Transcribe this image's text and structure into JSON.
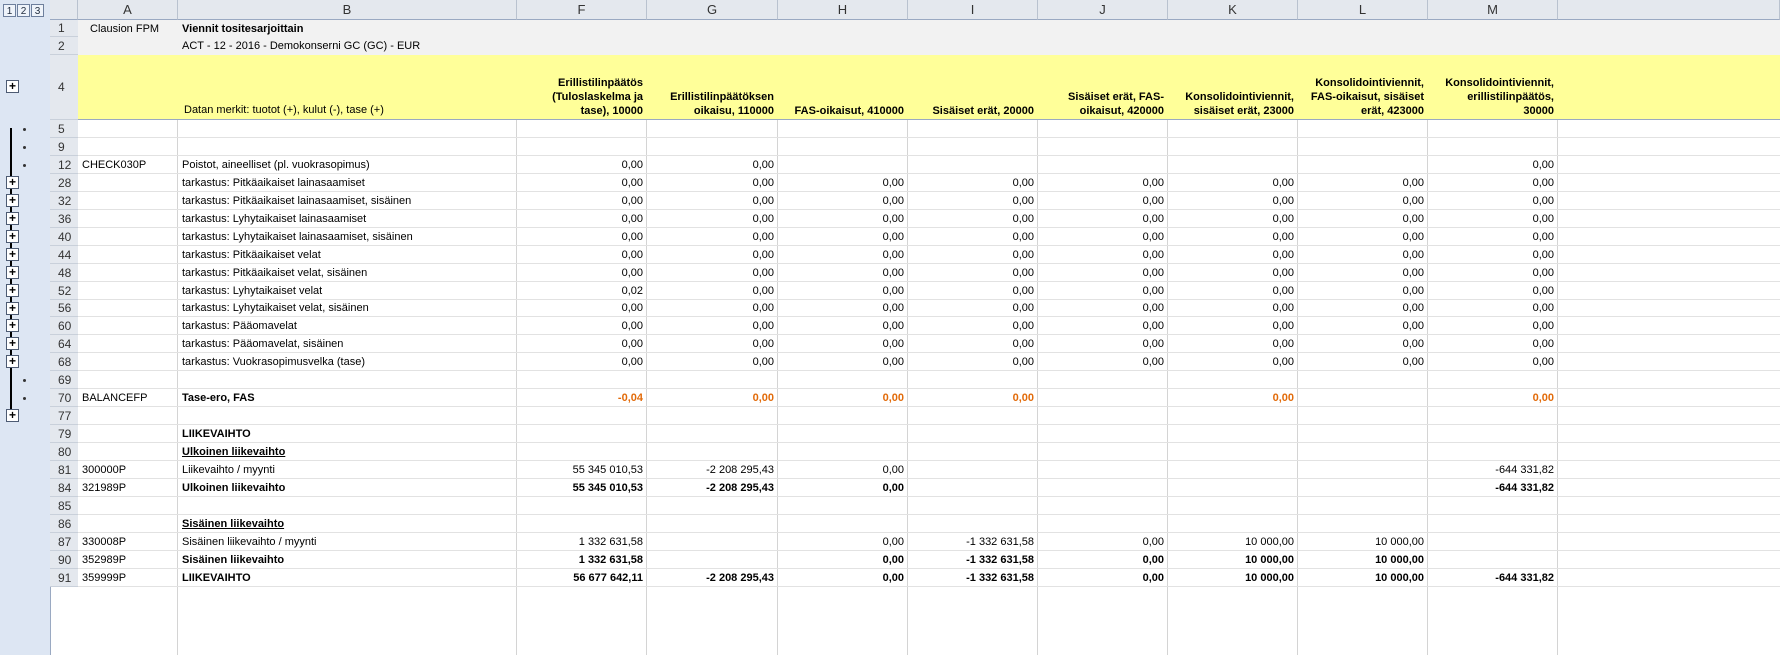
{
  "outline": {
    "levels": [
      "1",
      "2",
      "3"
    ],
    "plus_glyph": "+"
  },
  "columns": [
    "A",
    "B",
    "F",
    "G",
    "H",
    "I",
    "J",
    "K",
    "L",
    "M"
  ],
  "header": {
    "a1": "Clausion FPM",
    "b1": "Viennit tositesarjoittain",
    "b2": "ACT - 12 - 2016 - Demokonserni GC (GC) - EUR",
    "b4": "Datan merkit: tuotot (+), kulut (-), tase (+)",
    "f4": "Erillistilinpäätös\n(Tuloslaskelma ja\ntase), 10000",
    "g4": "Erillistilinpäätöksen\noikaisu, 110000",
    "h4": "FAS-oikaisut, 410000",
    "i4": "Sisäiset erät, 20000",
    "j4": "Sisäiset erät, FAS-\noikaisut, 420000",
    "k4": "Konsolidointiviennit,\nsisäiset erät, 23000",
    "l4": "Konsolidointiviennit,\nFAS-oikaisut, sisäiset\nerät, 423000",
    "m4": "Konsolidointiviennit,\nerillistilinpäätös,\n30000"
  },
  "rows": [
    {
      "n": "5",
      "a": "",
      "b": "",
      "f": "",
      "g": "",
      "h": "",
      "i": "",
      "j": "",
      "k": "",
      "l": "",
      "m": ""
    },
    {
      "n": "9",
      "a": "",
      "b": "",
      "f": "",
      "g": "",
      "h": "",
      "i": "",
      "j": "",
      "k": "",
      "l": "",
      "m": ""
    },
    {
      "n": "12",
      "a": "CHECK030P",
      "b": "Poistot, aineelliset (pl. vuokrasopimus)",
      "f": "0,00",
      "g": "0,00",
      "h": "",
      "i": "",
      "j": "",
      "k": "",
      "l": "",
      "m": "0,00"
    },
    {
      "n": "28",
      "a": "",
      "b": "tarkastus: Pitkäaikaiset lainasaamiset",
      "f": "0,00",
      "g": "0,00",
      "h": "0,00",
      "i": "0,00",
      "j": "0,00",
      "k": "0,00",
      "l": "0,00",
      "m": "0,00"
    },
    {
      "n": "32",
      "a": "",
      "b": "tarkastus: Pitkäaikaiset lainasaamiset, sisäinen",
      "f": "0,00",
      "g": "0,00",
      "h": "0,00",
      "i": "0,00",
      "j": "0,00",
      "k": "0,00",
      "l": "0,00",
      "m": "0,00"
    },
    {
      "n": "36",
      "a": "",
      "b": "tarkastus: Lyhytaikaiset lainasaamiset",
      "f": "0,00",
      "g": "0,00",
      "h": "0,00",
      "i": "0,00",
      "j": "0,00",
      "k": "0,00",
      "l": "0,00",
      "m": "0,00"
    },
    {
      "n": "40",
      "a": "",
      "b": "tarkastus: Lyhytaikaiset lainasaamiset, sisäinen",
      "f": "0,00",
      "g": "0,00",
      "h": "0,00",
      "i": "0,00",
      "j": "0,00",
      "k": "0,00",
      "l": "0,00",
      "m": "0,00"
    },
    {
      "n": "44",
      "a": "",
      "b": "tarkastus: Pitkäaikaiset velat",
      "f": "0,00",
      "g": "0,00",
      "h": "0,00",
      "i": "0,00",
      "j": "0,00",
      "k": "0,00",
      "l": "0,00",
      "m": "0,00"
    },
    {
      "n": "48",
      "a": "",
      "b": "tarkastus: Pitkäaikaiset velat, sisäinen",
      "f": "0,00",
      "g": "0,00",
      "h": "0,00",
      "i": "0,00",
      "j": "0,00",
      "k": "0,00",
      "l": "0,00",
      "m": "0,00"
    },
    {
      "n": "52",
      "a": "",
      "b": "tarkastus: Lyhytaikaiset velat",
      "f": "0,02",
      "g": "0,00",
      "h": "0,00",
      "i": "0,00",
      "j": "0,00",
      "k": "0,00",
      "l": "0,00",
      "m": "0,00"
    },
    {
      "n": "56",
      "a": "",
      "b": "tarkastus: Lyhytaikaiset velat, sisäinen",
      "f": "0,00",
      "g": "0,00",
      "h": "0,00",
      "i": "0,00",
      "j": "0,00",
      "k": "0,00",
      "l": "0,00",
      "m": "0,00"
    },
    {
      "n": "60",
      "a": "",
      "b": "tarkastus: Pääomavelat",
      "f": "0,00",
      "g": "0,00",
      "h": "0,00",
      "i": "0,00",
      "j": "0,00",
      "k": "0,00",
      "l": "0,00",
      "m": "0,00"
    },
    {
      "n": "64",
      "a": "",
      "b": "tarkastus: Pääomavelat, sisäinen",
      "f": "0,00",
      "g": "0,00",
      "h": "0,00",
      "i": "0,00",
      "j": "0,00",
      "k": "0,00",
      "l": "0,00",
      "m": "0,00"
    },
    {
      "n": "68",
      "a": "",
      "b": "tarkastus: Vuokrasopimusvelka (tase)",
      "f": "0,00",
      "g": "0,00",
      "h": "0,00",
      "i": "0,00",
      "j": "0,00",
      "k": "0,00",
      "l": "0,00",
      "m": "0,00"
    },
    {
      "n": "69",
      "a": "",
      "b": "",
      "f": "",
      "g": "",
      "h": "",
      "i": "",
      "j": "",
      "k": "",
      "l": "",
      "m": ""
    },
    {
      "n": "70",
      "a": "BALANCEFP",
      "b": "Tase-ero, FAS",
      "f": "-0,04",
      "g": "0,00",
      "h": "0,00",
      "i": "0,00",
      "j": "",
      "k": "0,00",
      "l": "",
      "m": "0,00",
      "style": "orange"
    },
    {
      "n": "77",
      "a": "",
      "b": "",
      "f": "",
      "g": "",
      "h": "",
      "i": "",
      "j": "",
      "k": "",
      "l": "",
      "m": ""
    },
    {
      "n": "79",
      "a": "",
      "b": "LIIKEVAIHTO",
      "f": "",
      "g": "",
      "h": "",
      "i": "",
      "j": "",
      "k": "",
      "l": "",
      "m": "",
      "style": "bold"
    },
    {
      "n": "80",
      "a": "",
      "b": "Ulkoinen liikevaihto",
      "f": "",
      "g": "",
      "h": "",
      "i": "",
      "j": "",
      "k": "",
      "l": "",
      "m": "",
      "style": "underline"
    },
    {
      "n": "81",
      "a": "300000P",
      "b": "Liikevaihto / myynti",
      "f": "55 345 010,53",
      "g": "-2 208 295,43",
      "h": "0,00",
      "i": "",
      "j": "",
      "k": "",
      "l": "",
      "m": "-644 331,82"
    },
    {
      "n": "84",
      "a": "321989P",
      "b": "Ulkoinen liikevaihto",
      "f": "55 345 010,53",
      "g": "-2 208 295,43",
      "h": "0,00",
      "i": "",
      "j": "",
      "k": "",
      "l": "",
      "m": "-644 331,82",
      "style": "bold"
    },
    {
      "n": "85",
      "a": "",
      "b": "",
      "f": "",
      "g": "",
      "h": "",
      "i": "",
      "j": "",
      "k": "",
      "l": "",
      "m": ""
    },
    {
      "n": "86",
      "a": "",
      "b": "Sisäinen liikevaihto",
      "f": "",
      "g": "",
      "h": "",
      "i": "",
      "j": "",
      "k": "",
      "l": "",
      "m": "",
      "style": "underline"
    },
    {
      "n": "87",
      "a": "330008P",
      "b": "Sisäinen liikevaihto / myynti",
      "f": "1 332 631,58",
      "g": "",
      "h": "0,00",
      "i": "-1 332 631,58",
      "j": "0,00",
      "k": "10 000,00",
      "l": "10 000,00",
      "m": ""
    },
    {
      "n": "90",
      "a": "352989P",
      "b": "Sisäinen liikevaihto",
      "f": "1 332 631,58",
      "g": "",
      "h": "0,00",
      "i": "-1 332 631,58",
      "j": "0,00",
      "k": "10 000,00",
      "l": "10 000,00",
      "m": "",
      "style": "bold"
    },
    {
      "n": "91",
      "a": "359999P",
      "b": "LIIKEVAIHTO",
      "f": "56 677 642,11",
      "g": "-2 208 295,43",
      "h": "0,00",
      "i": "-1 332 631,58",
      "j": "0,00",
      "k": "10 000,00",
      "l": "10 000,00",
      "m": "-644 331,82",
      "style": "bold"
    }
  ]
}
